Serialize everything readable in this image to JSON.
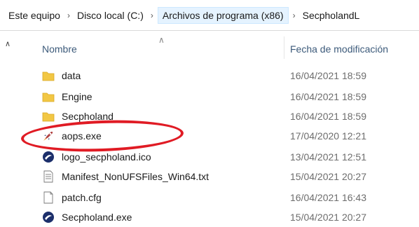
{
  "breadcrumb": [
    "Este equipo",
    "Disco local (C:)",
    "Archivos de programa (x86)",
    "SecpholandL"
  ],
  "columns": {
    "name": "Nombre",
    "date": "Fecha de modificación"
  },
  "files": [
    {
      "name": "data",
      "date": "16/04/2021 18:59",
      "icon": "folder-icon"
    },
    {
      "name": "Engine",
      "date": "16/04/2021 18:59",
      "icon": "folder-icon"
    },
    {
      "name": "Secpholand",
      "date": "16/04/2021 18:59",
      "icon": "folder-icon"
    },
    {
      "name": "aops.exe",
      "date": "17/04/2020 12:21",
      "icon": "rocket-exe-icon"
    },
    {
      "name": "logo_secpholand.ico",
      "date": "13/04/2021 12:51",
      "icon": "secpholand-logo-icon"
    },
    {
      "name": "Manifest_NonUFSFiles_Win64.txt",
      "date": "15/04/2021 20:27",
      "icon": "text-file-icon"
    },
    {
      "name": "patch.cfg",
      "date": "16/04/2021 16:43",
      "icon": "blank-file-icon"
    },
    {
      "name": "Secpholand.exe",
      "date": "15/04/2021 20:27",
      "icon": "secpholand-logo-icon"
    }
  ],
  "colors": {
    "highlight": "#e01b24",
    "folder": "#f2c744",
    "header_text": "#3c5a7a"
  }
}
